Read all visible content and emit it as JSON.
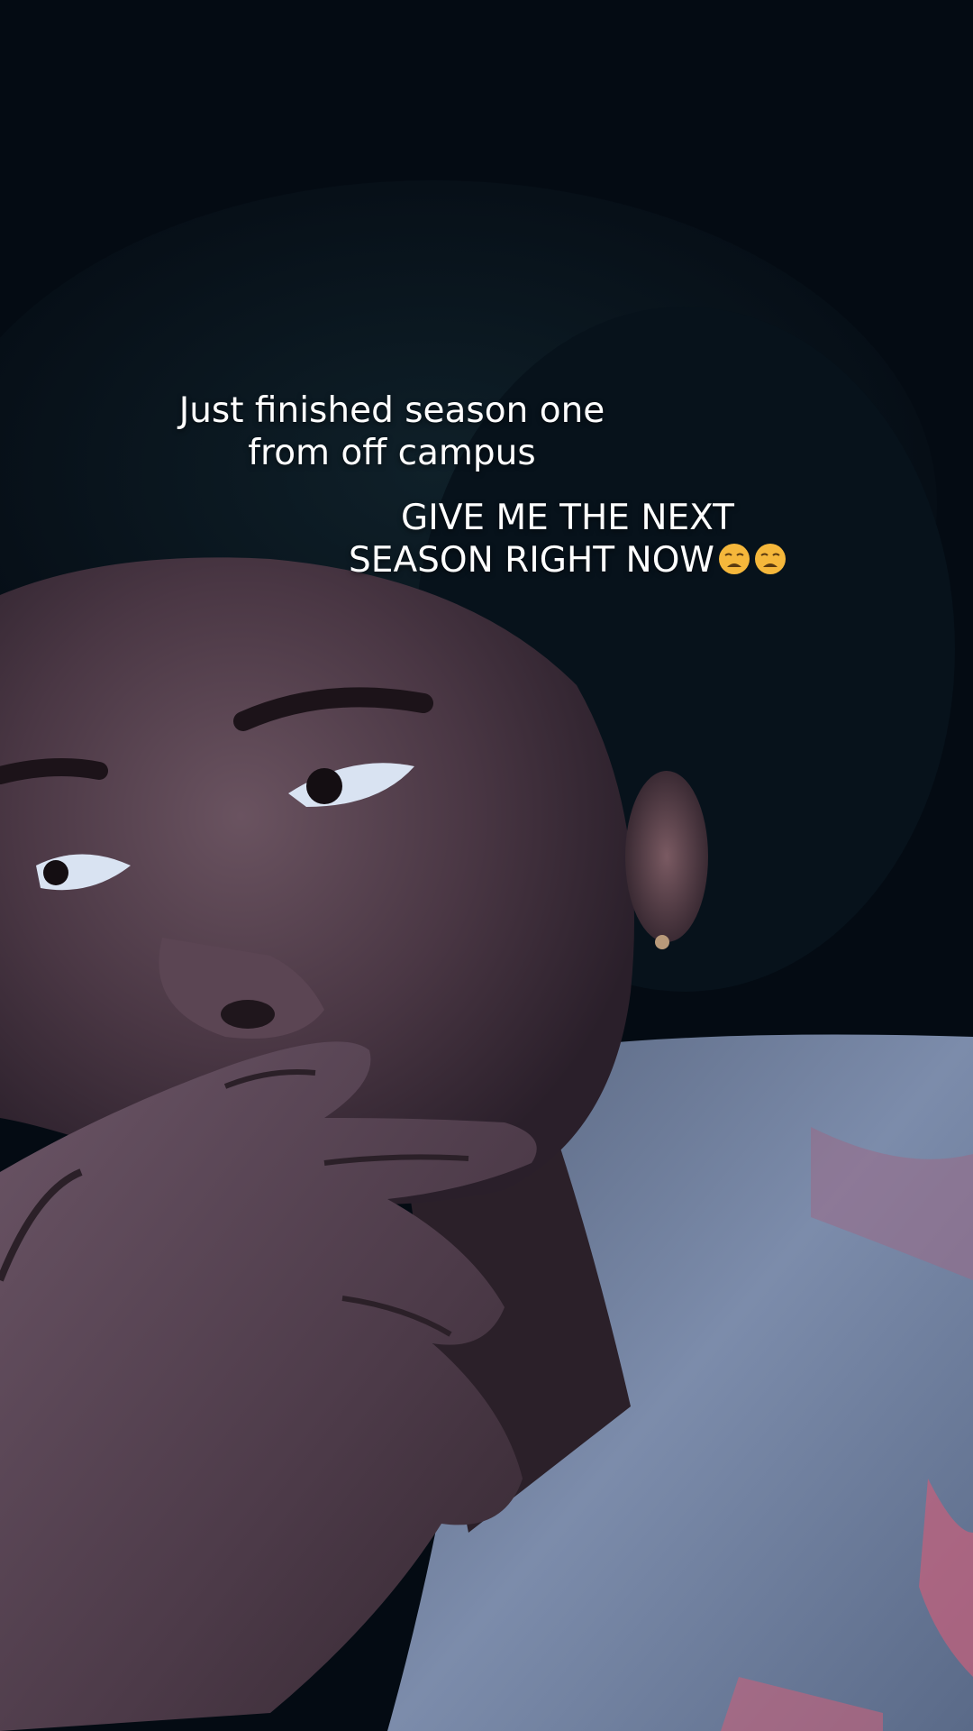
{
  "captions": {
    "line_group_1": "Just finished season one\nfrom off campus",
    "line_group_2": "GIVE ME THE NEXT\nSEASON RIGHT NOW"
  },
  "emoji": {
    "name": "weary-face-icon",
    "count": 2,
    "color": "#f5b73b"
  },
  "colors": {
    "background_dark": "#050d16",
    "skin_tone": "#4a3a44",
    "shirt": "#7a8aa8",
    "shirt_pink": "#c8607a"
  }
}
